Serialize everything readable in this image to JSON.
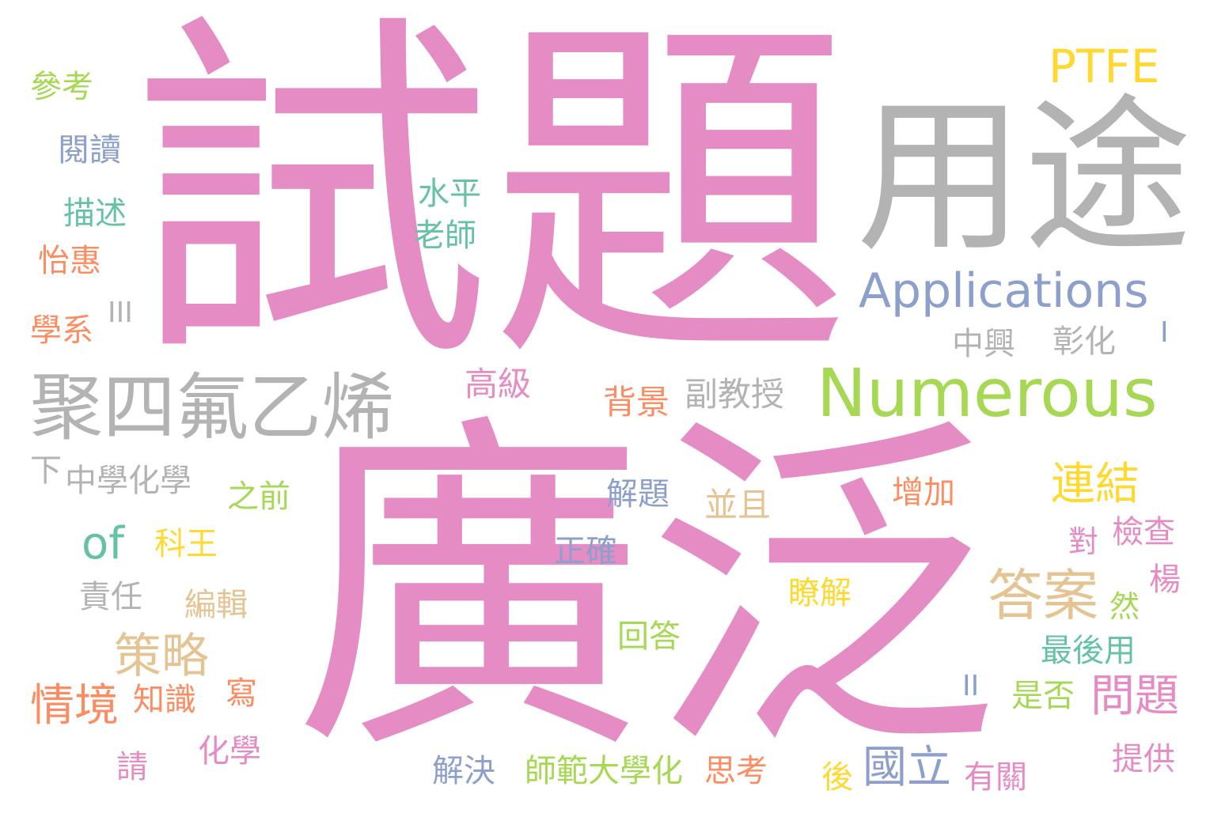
{
  "colors": {
    "pink": "#e58cc5",
    "gray": "#b3b3b3",
    "green": "#a6d854",
    "teal": "#66c2a5",
    "orange": "#fc8d62",
    "blue": "#8da0cb",
    "yellow": "#ffd92f",
    "tan": "#e5c494"
  },
  "words": [
    {
      "text": "試題",
      "color": "#e58cc5"
    },
    {
      "text": "廣泛",
      "color": "#e58cc5"
    },
    {
      "text": "用途",
      "color": "#b3b3b3"
    },
    {
      "text": "Applications",
      "color": "#8da0cb"
    },
    {
      "text": "Numerous",
      "color": "#a6d854"
    },
    {
      "text": "PTFE",
      "color": "#ffd92f"
    },
    {
      "text": "聚四氟乙烯",
      "color": "#b3b3b3"
    },
    {
      "text": "參考",
      "color": "#a6d854"
    },
    {
      "text": "閱讀",
      "color": "#8da0cb"
    },
    {
      "text": "描述",
      "color": "#66c2a5"
    },
    {
      "text": "怡惠",
      "color": "#fc8d62"
    },
    {
      "text": "學系",
      "color": "#fc8d62"
    },
    {
      "text": "III",
      "color": "#b3b3b3"
    },
    {
      "text": "水平",
      "color": "#66c2a5"
    },
    {
      "text": "老師",
      "color": "#66c2a5"
    },
    {
      "text": "中興",
      "color": "#b3b3b3"
    },
    {
      "text": "彰化",
      "color": "#b3b3b3"
    },
    {
      "text": "I",
      "color": "#8da0cb"
    },
    {
      "text": "高級",
      "color": "#e58cc5"
    },
    {
      "text": "背景",
      "color": "#fc8d62"
    },
    {
      "text": "副教授",
      "color": "#b3b3b3"
    },
    {
      "text": "下",
      "color": "#b3b3b3"
    },
    {
      "text": "中學化學",
      "color": "#b3b3b3"
    },
    {
      "text": "之前",
      "color": "#a6d854"
    },
    {
      "text": "連結",
      "color": "#ffd92f"
    },
    {
      "text": "of",
      "color": "#66c2a5"
    },
    {
      "text": "科王",
      "color": "#ffd92f"
    },
    {
      "text": "解題",
      "color": "#8da0cb"
    },
    {
      "text": "並且",
      "color": "#e5c494"
    },
    {
      "text": "增加",
      "color": "#fc8d62"
    },
    {
      "text": "對",
      "color": "#e58cc5"
    },
    {
      "text": "檢查",
      "color": "#e58cc5"
    },
    {
      "text": "正確",
      "color": "#8da0cb"
    },
    {
      "text": "責任",
      "color": "#b3b3b3"
    },
    {
      "text": "編輯",
      "color": "#e5c494"
    },
    {
      "text": "答案",
      "color": "#e5c494"
    },
    {
      "text": "楊",
      "color": "#e58cc5"
    },
    {
      "text": "瞭解",
      "color": "#ffd92f"
    },
    {
      "text": "然",
      "color": "#a6d854"
    },
    {
      "text": "策略",
      "color": "#e5c494"
    },
    {
      "text": "回答",
      "color": "#a6d854"
    },
    {
      "text": "最後用",
      "color": "#66c2a5"
    },
    {
      "text": "情境",
      "color": "#fc8d62"
    },
    {
      "text": "知識",
      "color": "#fc8d62"
    },
    {
      "text": "寫",
      "color": "#fc8d62"
    },
    {
      "text": "II",
      "color": "#8da0cb"
    },
    {
      "text": "是否",
      "color": "#a6d854"
    },
    {
      "text": "問題",
      "color": "#e58cc5"
    },
    {
      "text": "化學",
      "color": "#e58cc5"
    },
    {
      "text": "請",
      "color": "#e58cc5"
    },
    {
      "text": "解決",
      "color": "#8da0cb"
    },
    {
      "text": "師範大學化",
      "color": "#a6d854"
    },
    {
      "text": "思考",
      "color": "#fc8d62"
    },
    {
      "text": "後",
      "color": "#ffd92f"
    },
    {
      "text": "國立",
      "color": "#8da0cb"
    },
    {
      "text": "有關",
      "color": "#e58cc5"
    },
    {
      "text": "提供",
      "color": "#e58cc5"
    }
  ]
}
